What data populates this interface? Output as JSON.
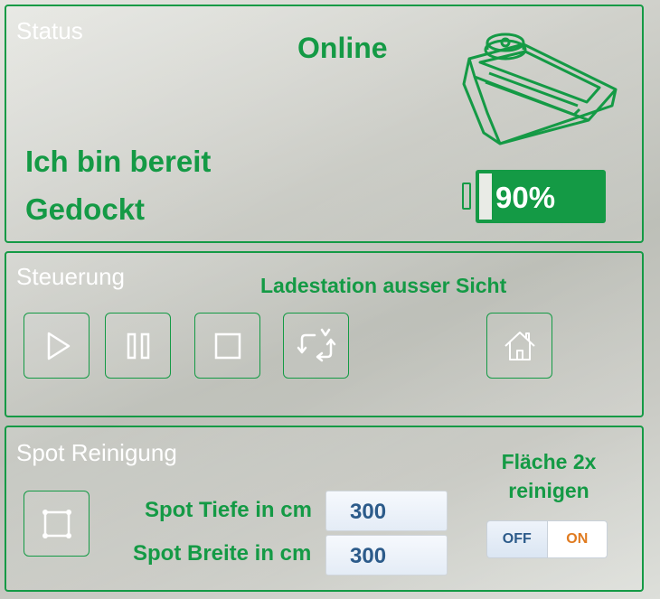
{
  "status": {
    "title": "Status",
    "connection": "Online",
    "state": "Ich bin bereit",
    "dock_state": "Gedockt",
    "battery": {
      "label": "90%",
      "level": 0.9
    },
    "robot_icon": "robot-vacuum-icon"
  },
  "control": {
    "title": "Steuerung",
    "message": "Ladestation ausser Sicht",
    "buttons": [
      {
        "icon": "play-icon"
      },
      {
        "icon": "pause-icon"
      },
      {
        "icon": "stop-icon"
      },
      {
        "icon": "repeat-icon"
      },
      {
        "icon": "home-icon"
      }
    ]
  },
  "spot": {
    "title": "Spot Reinigung",
    "start_icon": "spot-square-icon",
    "depth_label": "Spot Tiefe in cm",
    "depth_value": "300",
    "width_label": "Spot Breite in cm",
    "width_value": "300",
    "area_label_line1": "Fläche 2x",
    "area_label_line2": "reinigen",
    "toggle": {
      "off_label": "OFF",
      "on_label": "ON",
      "selected": "ON"
    }
  },
  "colors": {
    "accent": "#149a45",
    "toggle_on": "#e07b20",
    "input_text": "#2c5b8a"
  }
}
